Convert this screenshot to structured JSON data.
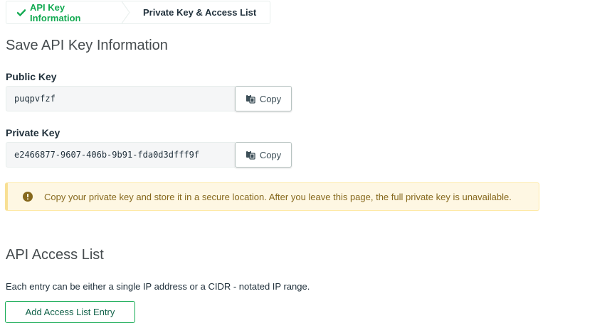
{
  "wizard": {
    "steps": [
      {
        "label": "API Key Information",
        "status": "completed"
      },
      {
        "label": "Private Key & Access List",
        "status": "current"
      }
    ]
  },
  "save_section": {
    "title": "Save API Key Information",
    "public_key": {
      "label": "Public Key",
      "value": "puqpvfzf",
      "copy_label": "Copy"
    },
    "private_key": {
      "label": "Private Key",
      "value": "e2466877-9607-406b-9b91-fda0d3dfff9f",
      "copy_label": "Copy"
    },
    "warning": "Copy your private key and store it in a secure location. After you leave this page, the full private key is unavailable."
  },
  "access_section": {
    "title": "API Access List",
    "description": "Each entry can be either a single IP address or a CIDR - notated IP range.",
    "add_button": "Add Access List Entry"
  },
  "colors": {
    "accent_green": "#13aa52",
    "warning_bg": "#fef7e3",
    "warning_text": "#86681d"
  },
  "icons": {
    "completed_step": "checkmark-icon",
    "copy": "clipboard-icon",
    "warning": "warning-circle-icon"
  }
}
